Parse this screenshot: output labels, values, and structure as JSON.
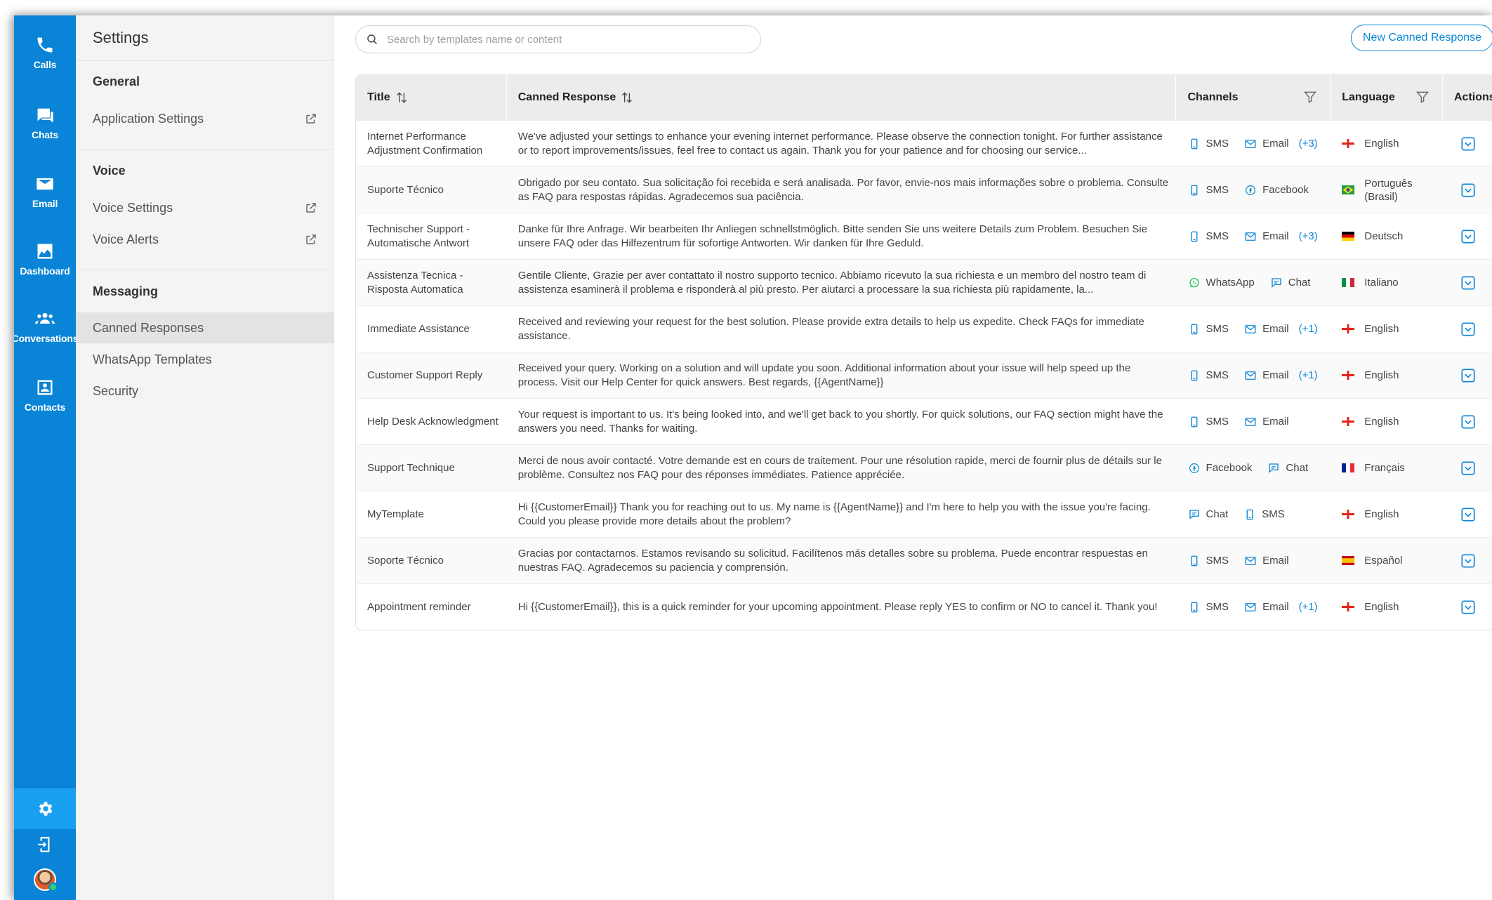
{
  "rail": {
    "items": [
      {
        "label": "Calls",
        "icon": "phone-icon"
      },
      {
        "label": "Chats",
        "icon": "chat-bubble-icon"
      },
      {
        "label": "Email",
        "icon": "envelope-icon"
      },
      {
        "label": "Dashboard",
        "icon": "chart-icon"
      },
      {
        "label": "Conversations",
        "icon": "people-icon"
      },
      {
        "label": "Contacts",
        "icon": "contact-card-icon"
      }
    ],
    "bottom": [
      "gear-icon",
      "logout-device-icon",
      "user-avatar"
    ]
  },
  "settings": {
    "title": "Settings",
    "sections": [
      {
        "heading": "General",
        "items": [
          {
            "label": "Application Settings",
            "external": true
          }
        ]
      },
      {
        "heading": "Voice",
        "items": [
          {
            "label": "Voice Settings",
            "external": true
          },
          {
            "label": "Voice Alerts",
            "external": true
          }
        ]
      },
      {
        "heading": "Messaging",
        "items": [
          {
            "label": "Canned Responses",
            "active": true
          },
          {
            "label": "WhatsApp Templates"
          },
          {
            "label": "Security"
          }
        ]
      }
    ]
  },
  "main": {
    "search_placeholder": "Search by templates name or content",
    "new_button": "New Canned Response",
    "columns": {
      "title": "Title",
      "response": "Canned Response",
      "channels": "Channels",
      "language": "Language",
      "actions": "Actions"
    },
    "rows": [
      {
        "title": "Internet Performance Adjustment Confirmation",
        "response": "We've adjusted your settings to enhance your evening internet performance. Please observe the connection tonight. For further assistance or to report improvements/issues, feel free to contact us again. Thank you for your patience and for choosing our service...",
        "channels": [
          {
            "name": "SMS",
            "icon": "sms-icon"
          },
          {
            "name": "Email",
            "icon": "email-icon"
          }
        ],
        "more": "(+3)",
        "language": "English",
        "flag": "en"
      },
      {
        "title": "Suporte Técnico",
        "response": "Obrigado por seu contato. Sua solicitação foi recebida e será analisada. Por favor, envie-nos mais informações sobre o problema. Consulte as FAQ para respostas rápidas. Agradecemos sua paciência.",
        "channels": [
          {
            "name": "SMS",
            "icon": "sms-icon"
          },
          {
            "name": "Facebook",
            "icon": "facebook-icon"
          }
        ],
        "more": "",
        "language": "Português (Brasil)",
        "flag": "br"
      },
      {
        "title": "Technischer Support - Automatische Antwort",
        "response": "Danke für Ihre Anfrage. Wir bearbeiten Ihr Anliegen schnellstmöglich. Bitte senden Sie uns weitere Details zum Problem. Besuchen Sie unsere FAQ oder das Hilfezentrum für sofortige Antworten. Wir danken für Ihre Geduld.",
        "channels": [
          {
            "name": "SMS",
            "icon": "sms-icon"
          },
          {
            "name": "Email",
            "icon": "email-icon"
          }
        ],
        "more": "(+3)",
        "language": "Deutsch",
        "flag": "de"
      },
      {
        "title": "Assistenza Tecnica - Risposta Automatica",
        "response": "Gentile Cliente, Grazie per aver contattato il nostro supporto tecnico. Abbiamo ricevuto la sua richiesta e un membro del nostro team di assistenza esaminerà il problema e risponderà al più presto. Per aiutarci a processare la sua richiesta più rapidamente, la...",
        "channels": [
          {
            "name": "WhatsApp",
            "icon": "whatsapp-icon"
          },
          {
            "name": "Chat",
            "icon": "chat-icon"
          }
        ],
        "more": "",
        "language": "Italiano",
        "flag": "it"
      },
      {
        "title": "Immediate Assistance",
        "response": "Received and reviewing your request for the best solution. Please provide extra details to help us expedite. Check FAQs for immediate assistance.",
        "channels": [
          {
            "name": "SMS",
            "icon": "sms-icon"
          },
          {
            "name": "Email",
            "icon": "email-icon"
          }
        ],
        "more": "(+1)",
        "language": "English",
        "flag": "en"
      },
      {
        "title": "Customer Support Reply",
        "response": "Received your query. Working on a solution and will update you soon. Additional information about your issue will help speed up the process. Visit our Help Center for quick answers. Best regards, {{AgentName}}",
        "channels": [
          {
            "name": "SMS",
            "icon": "sms-icon"
          },
          {
            "name": "Email",
            "icon": "email-icon"
          }
        ],
        "more": "(+1)",
        "language": "English",
        "flag": "en"
      },
      {
        "title": "Help Desk Acknowledgment",
        "response": "Your request is important to us. It's being looked into, and we'll get back to you shortly. For quick solutions, our FAQ section might have the answers you need. Thanks for waiting.",
        "channels": [
          {
            "name": "SMS",
            "icon": "sms-icon"
          },
          {
            "name": "Email",
            "icon": "email-icon"
          }
        ],
        "more": "",
        "language": "English",
        "flag": "en"
      },
      {
        "title": "Support Technique",
        "response": "Merci de nous avoir contacté. Votre demande est en cours de traitement. Pour une résolution rapide, merci de fournir plus de détails sur le problème. Consultez nos FAQ pour des réponses immédiates. Patience appréciée.",
        "channels": [
          {
            "name": "Facebook",
            "icon": "facebook-icon"
          },
          {
            "name": "Chat",
            "icon": "chat-icon"
          }
        ],
        "more": "",
        "language": "Français",
        "flag": "fr"
      },
      {
        "title": "MyTemplate",
        "response": "Hi {{CustomerEmail}} Thank you for reaching out to us. My name is {{AgentName}} and I'm here to help you with the issue you're facing. Could you please provide more details about the problem?",
        "channels": [
          {
            "name": "Chat",
            "icon": "chat-icon"
          },
          {
            "name": "SMS",
            "icon": "sms-icon"
          }
        ],
        "more": "",
        "language": "English",
        "flag": "en"
      },
      {
        "title": "Soporte Técnico",
        "response": "Gracias por contactarnos. Estamos revisando su solicitud. Facilítenos más detalles sobre su problema. Puede encontrar respuestas en nuestras FAQ. Agradecemos su paciencia y comprensión.",
        "channels": [
          {
            "name": "SMS",
            "icon": "sms-icon"
          },
          {
            "name": "Email",
            "icon": "email-icon"
          }
        ],
        "more": "",
        "language": "Español",
        "flag": "es"
      },
      {
        "title": "Appointment reminder",
        "response": "Hi {{CustomerEmail}}, this is a quick reminder for your upcoming appointment. Please reply YES to confirm or NO to cancel it. Thank you!",
        "channels": [
          {
            "name": "SMS",
            "icon": "sms-icon"
          },
          {
            "name": "Email",
            "icon": "email-icon"
          }
        ],
        "more": "(+1)",
        "language": "English",
        "flag": "en"
      }
    ]
  },
  "colors": {
    "brand": "#0a84d6",
    "rail_active": "#1aa0f0",
    "link": "#0a84d6"
  }
}
